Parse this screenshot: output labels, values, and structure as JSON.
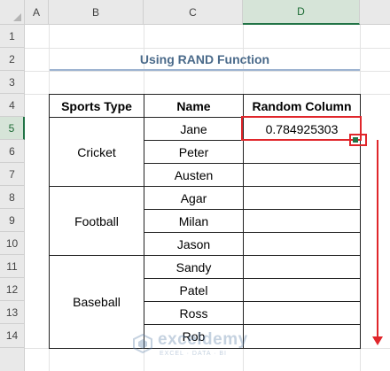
{
  "columns": [
    "A",
    "B",
    "C",
    "D"
  ],
  "rows": [
    "1",
    "2",
    "3",
    "4",
    "5",
    "6",
    "7",
    "8",
    "9",
    "10",
    "11",
    "12",
    "13",
    "14"
  ],
  "title": "Using RAND Function",
  "table": {
    "headers": [
      "Sports Type",
      "Name",
      "Random Column"
    ],
    "groups": [
      {
        "sport": "Cricket",
        "names": [
          "Jane",
          "Peter",
          "Austen"
        ]
      },
      {
        "sport": "Football",
        "names": [
          "Agar",
          "Milan",
          "Jason"
        ]
      },
      {
        "sport": "Baseball",
        "names": [
          "Sandy",
          "Patel",
          "Ross",
          "Rob"
        ]
      }
    ],
    "random_values": [
      "0.784925303"
    ]
  },
  "selection": {
    "cell": "D5"
  },
  "watermark": {
    "brand": "exceldemy",
    "tagline": "EXCEL · DATA · BI"
  },
  "colors": {
    "highlight": "#e0262b",
    "excel_green": "#217346"
  }
}
